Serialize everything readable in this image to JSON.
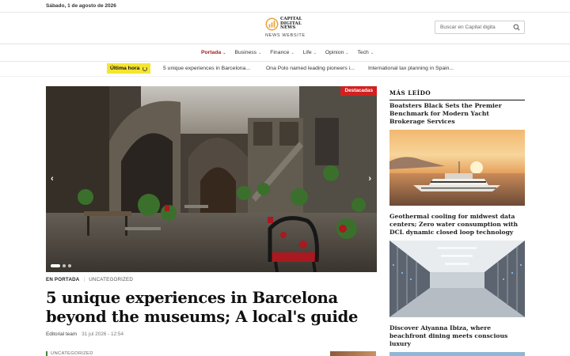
{
  "topbar": {
    "date": "Sábado, 1 de agosto de 2026"
  },
  "logo": {
    "brand_lines": [
      "CAPITAL",
      "DIGITAL",
      "NEWS"
    ],
    "tagline": "NEWS WEBSITE"
  },
  "search": {
    "placeholder": "Buscar en Capital digita"
  },
  "nav": {
    "items": [
      "Portada",
      "Business",
      "Finance",
      "Life",
      "Opinion",
      "Tech"
    ],
    "active": "Portada"
  },
  "ticker": {
    "label": "Última hora",
    "headlines": [
      "5 unique experiences in Barcelona...",
      "Ona Polo named leading pioneers i...",
      "International tax planning in Spain..."
    ]
  },
  "featured": {
    "badge": "Destacadas",
    "category_primary": "EN PORTADA",
    "category_secondary": "UNCATEGORIZED",
    "title": "5 unique experiences in Barcelona beyond the museums; A local's guide",
    "author": "Editorial team",
    "datetime": "31 jul 2026 - 12:54",
    "slide_count": 3,
    "active_slide": 1
  },
  "next_article": {
    "category": "UNCATEGORIZED"
  },
  "sidebar": {
    "heading": "MÁS LEÍDO",
    "items": [
      {
        "title": "Boatsters Black Sets the Premier Benchmark for Modern Yacht Brokerage Services"
      },
      {
        "title": "Geothermal cooling for midwest data centers; Zero water consumption with DCL dynamic closed loop technology"
      },
      {
        "title": "Discover Aiyanna Ibiza, where beachfront dining meets conscious luxury"
      }
    ]
  },
  "colors": {
    "accent_red": "#a11d1d",
    "badge_red": "#d1201f",
    "ticker_yellow": "#f5e531",
    "logo_orange": "#e9a23b"
  }
}
